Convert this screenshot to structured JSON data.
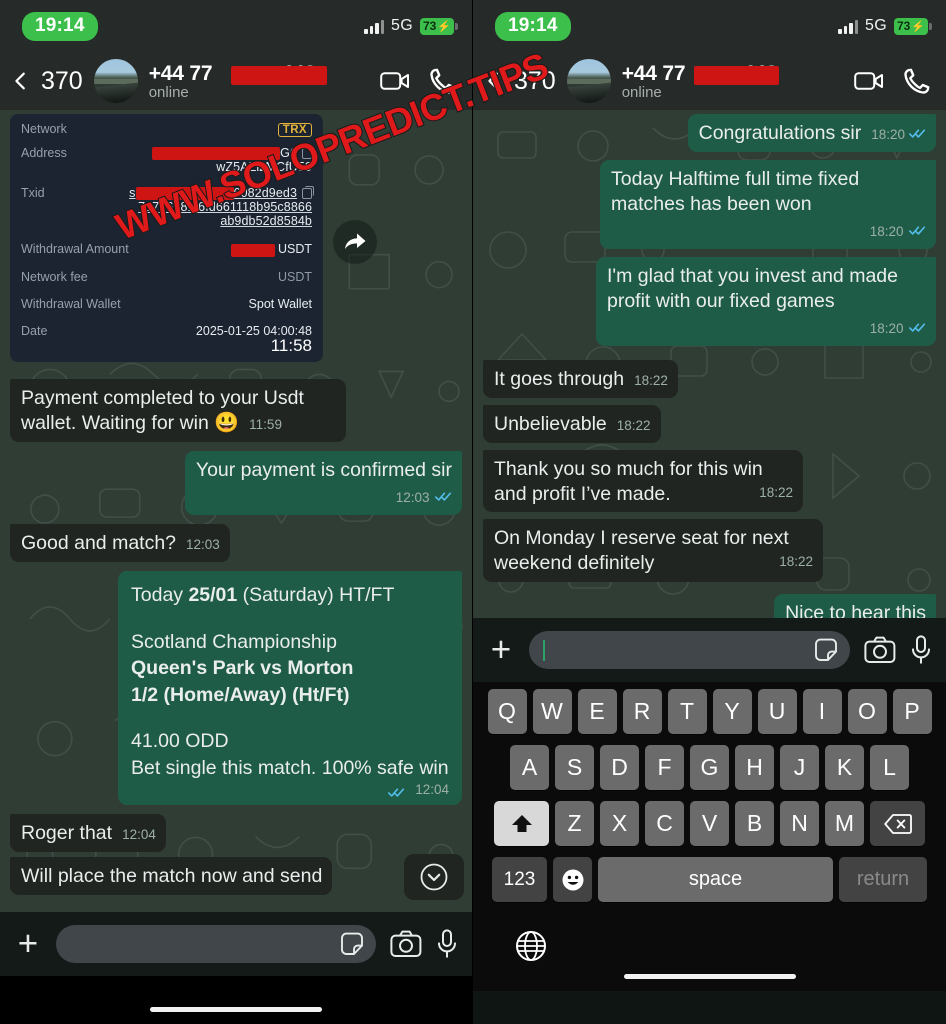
{
  "watermark": {
    "text": "WWW.SOLOPREDICT.TIPS",
    "color": "#e01a1a"
  },
  "status_bar": {
    "time": "19:14",
    "network_type": "5G",
    "battery_percent": "73",
    "battery_charging_glyph": "⚡",
    "time_pill_color": "#3cc04b"
  },
  "header": {
    "back_label": "370",
    "contact_name_prefix": "+44 77",
    "contact_name_suffix": "442",
    "contact_name_full": "+44 77█████442",
    "presence": "online",
    "video_icon": "video-call-icon",
    "voice_icon": "voice-call-icon",
    "avatar_icon": "contact-avatar"
  },
  "left_panel": {
    "transaction_card": {
      "rows": [
        {
          "label": "Network",
          "value": "TRX",
          "type": "badge"
        },
        {
          "label": "Address",
          "value": "████████G6",
          "value2": "wZ5AZizMCfU59",
          "type": "redacted"
        },
        {
          "label": "Txid",
          "value": "██████6082d9ed3",
          "value2": "717e6281f6fd661118b95c8866",
          "value3": "ab9db52d8584b",
          "type": "redacted"
        },
        {
          "label": "Withdrawal Amount",
          "value": "████ USDT",
          "type": "redacted"
        },
        {
          "label": "Network fee",
          "value": "███ USDT",
          "type": "redacted"
        },
        {
          "label": "Withdrawal Wallet",
          "value": "Spot Wallet",
          "type": "text"
        },
        {
          "label": "Date",
          "value": "2025-01-25 04:00:48",
          "type": "text"
        }
      ],
      "time": "11:58",
      "forward_icon": "forward-arrow-icon"
    },
    "messages": [
      {
        "dir": "in",
        "text": "Payment completed to your Usdt wallet. Waiting for win 😃",
        "time": "11:59",
        "ticks": false
      },
      {
        "dir": "out",
        "text": "Your payment is confirmed sir",
        "time": "12:03",
        "ticks": true,
        "time_block": true
      },
      {
        "dir": "in",
        "text": "Good and match?",
        "time": "12:03",
        "ticks": false
      },
      {
        "dir": "out",
        "text": "Today 25/01 (Saturday) HT/FT\n\nScotland Championship\nQueen's Park vs Morton\n1/2 (Home/Away) (Ht/Ft)\n\n41.00 ODD\nBet single this match. 100% safe win",
        "time": "12:04",
        "ticks": true,
        "time_block": true,
        "rich": true
      },
      {
        "dir": "in",
        "text": "Roger that",
        "time": "12:04",
        "ticks": false
      },
      {
        "dir": "in",
        "text": "Will place the match now and send",
        "time": "",
        "ticks": false,
        "clipped": true
      }
    ],
    "tip_lines": [
      {
        "text": "Today ",
        "bold": false
      },
      {
        "text": "25/01",
        "bold": true
      },
      {
        "text": " (Saturday) HT/FT",
        "bold": false
      }
    ],
    "tip_body": {
      "league": "Scotland Championship",
      "match": "Queen's Park vs Morton",
      "pick": "1/2 (Home/Away) (Ht/Ft)",
      "odd": "41.00 ODD",
      "note": "Bet single this match. 100% safe win"
    },
    "scroll_button_icon": "chevron-down-icon",
    "input": {
      "placeholder": "",
      "value": "",
      "plus_icon": "attach-plus-icon",
      "sticker_icon": "sticker-icon",
      "camera_icon": "camera-icon",
      "mic_icon": "microphone-icon"
    }
  },
  "right_panel": {
    "messages": [
      {
        "dir": "out",
        "text": "Congratulations sir",
        "time": "18:20",
        "ticks": true
      },
      {
        "dir": "out",
        "text": "Today Halftime full time fixed matches has been won",
        "time": "18:20",
        "ticks": true,
        "time_block": true
      },
      {
        "dir": "out",
        "text": "I'm glad that you invest and made profit with our fixed games",
        "time": "18:20",
        "ticks": true,
        "time_block": true
      },
      {
        "dir": "in",
        "text": "It goes through",
        "time": "18:22",
        "ticks": false
      },
      {
        "dir": "in",
        "text": "Unbelievable",
        "time": "18:22",
        "ticks": false
      },
      {
        "dir": "in",
        "text": "Thank you so much for this win and profit I’ve made.",
        "time": "18:22",
        "ticks": false,
        "time_block": true
      },
      {
        "dir": "in",
        "text": "On Monday I reserve seat for next weekend definitely",
        "time": "18:22",
        "ticks": false,
        "time_block": true
      },
      {
        "dir": "out",
        "text": "Nice to hear this",
        "time": "",
        "ticks": false,
        "clipped": true
      }
    ],
    "input": {
      "placeholder": "",
      "value": "",
      "plus_icon": "attach-plus-icon",
      "sticker_icon": "sticker-icon",
      "camera_icon": "camera-icon",
      "mic_icon": "microphone-icon"
    },
    "keyboard": {
      "row1": [
        "Q",
        "W",
        "E",
        "R",
        "T",
        "Y",
        "U",
        "I",
        "O",
        "P"
      ],
      "row2": [
        "A",
        "S",
        "D",
        "F",
        "G",
        "H",
        "J",
        "K",
        "L"
      ],
      "row3": [
        "Z",
        "X",
        "C",
        "V",
        "B",
        "N",
        "M"
      ],
      "shift_label": "shift-key",
      "backspace_label": "backspace-key",
      "numbers_label": "123",
      "emoji_label": "emoji-key",
      "space_label": "space",
      "return_label": "return",
      "globe_label": "globe-key"
    }
  }
}
